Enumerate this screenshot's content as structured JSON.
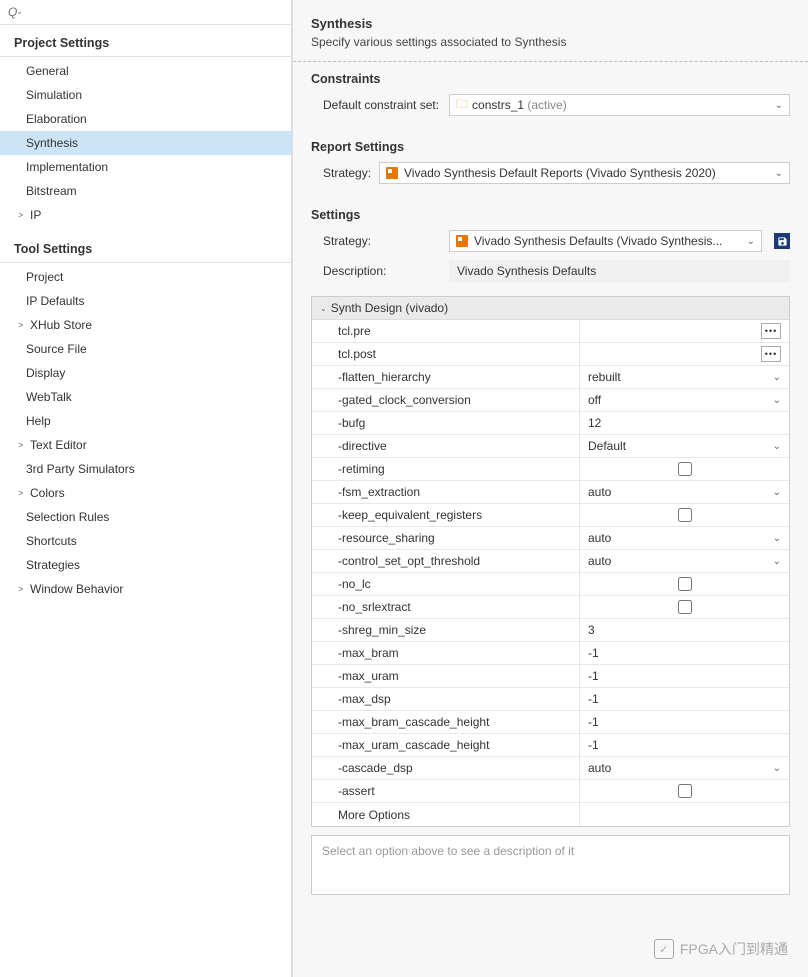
{
  "search_placeholder": "Q-",
  "sidebar": {
    "project_header": "Project Settings",
    "project_items": [
      {
        "label": "General",
        "chevron": false,
        "selected": false
      },
      {
        "label": "Simulation",
        "chevron": false,
        "selected": false
      },
      {
        "label": "Elaboration",
        "chevron": false,
        "selected": false
      },
      {
        "label": "Synthesis",
        "chevron": false,
        "selected": true
      },
      {
        "label": "Implementation",
        "chevron": false,
        "selected": false
      },
      {
        "label": "Bitstream",
        "chevron": false,
        "selected": false
      },
      {
        "label": "IP",
        "chevron": true,
        "selected": false
      }
    ],
    "tool_header": "Tool Settings",
    "tool_items": [
      {
        "label": "Project",
        "chevron": false
      },
      {
        "label": "IP Defaults",
        "chevron": false
      },
      {
        "label": "XHub Store",
        "chevron": true
      },
      {
        "label": "Source File",
        "chevron": false
      },
      {
        "label": "Display",
        "chevron": false
      },
      {
        "label": "WebTalk",
        "chevron": false
      },
      {
        "label": "Help",
        "chevron": false
      },
      {
        "label": "Text Editor",
        "chevron": true
      },
      {
        "label": "3rd Party Simulators",
        "chevron": false
      },
      {
        "label": "Colors",
        "chevron": true
      },
      {
        "label": "Selection Rules",
        "chevron": false
      },
      {
        "label": "Shortcuts",
        "chevron": false
      },
      {
        "label": "Strategies",
        "chevron": false
      },
      {
        "label": "Window Behavior",
        "chevron": true
      }
    ]
  },
  "header": {
    "title": "Synthesis",
    "subtitle": "Specify various settings associated to Synthesis"
  },
  "constraints": {
    "title": "Constraints",
    "label": "Default constraint set:",
    "value": "constrs_1",
    "suffix": "(active)"
  },
  "report": {
    "title": "Report Settings",
    "label": "Strategy:",
    "value": "Vivado Synthesis Default Reports (Vivado Synthesis 2020)"
  },
  "settings": {
    "title": "Settings",
    "strategy_label": "Strategy:",
    "strategy_value": "Vivado Synthesis Defaults (Vivado Synthesis...",
    "description_label": "Description:",
    "description_value": "Vivado Synthesis Defaults",
    "group_name": "Synth Design (vivado)",
    "rows": [
      {
        "name": "tcl.pre",
        "type": "browse",
        "value": ""
      },
      {
        "name": "tcl.post",
        "type": "browse",
        "value": ""
      },
      {
        "name": "-flatten_hierarchy",
        "type": "dropdown",
        "value": "rebuilt"
      },
      {
        "name": "-gated_clock_conversion",
        "type": "dropdown",
        "value": "off"
      },
      {
        "name": "-bufg",
        "type": "text",
        "value": "12"
      },
      {
        "name": "-directive",
        "type": "dropdown",
        "value": "Default"
      },
      {
        "name": "-retiming",
        "type": "checkbox",
        "checked": false
      },
      {
        "name": "-fsm_extraction",
        "type": "dropdown",
        "value": "auto"
      },
      {
        "name": "-keep_equivalent_registers",
        "type": "checkbox",
        "checked": false
      },
      {
        "name": "-resource_sharing",
        "type": "dropdown",
        "value": "auto"
      },
      {
        "name": "-control_set_opt_threshold",
        "type": "dropdown",
        "value": "auto"
      },
      {
        "name": "-no_lc",
        "type": "checkbox",
        "checked": false
      },
      {
        "name": "-no_srlextract",
        "type": "checkbox",
        "checked": false
      },
      {
        "name": "-shreg_min_size",
        "type": "text",
        "value": "3"
      },
      {
        "name": "-max_bram",
        "type": "text",
        "value": "-1"
      },
      {
        "name": "-max_uram",
        "type": "text",
        "value": "-1"
      },
      {
        "name": "-max_dsp",
        "type": "text",
        "value": "-1"
      },
      {
        "name": "-max_bram_cascade_height",
        "type": "text",
        "value": "-1"
      },
      {
        "name": "-max_uram_cascade_height",
        "type": "text",
        "value": "-1"
      },
      {
        "name": "-cascade_dsp",
        "type": "dropdown",
        "value": "auto"
      },
      {
        "name": "-assert",
        "type": "checkbox",
        "checked": false
      },
      {
        "name": "More Options",
        "type": "text",
        "value": ""
      }
    ]
  },
  "desc_placeholder": "Select an option above to see a description of it",
  "watermark": "FPGA入门到精通"
}
